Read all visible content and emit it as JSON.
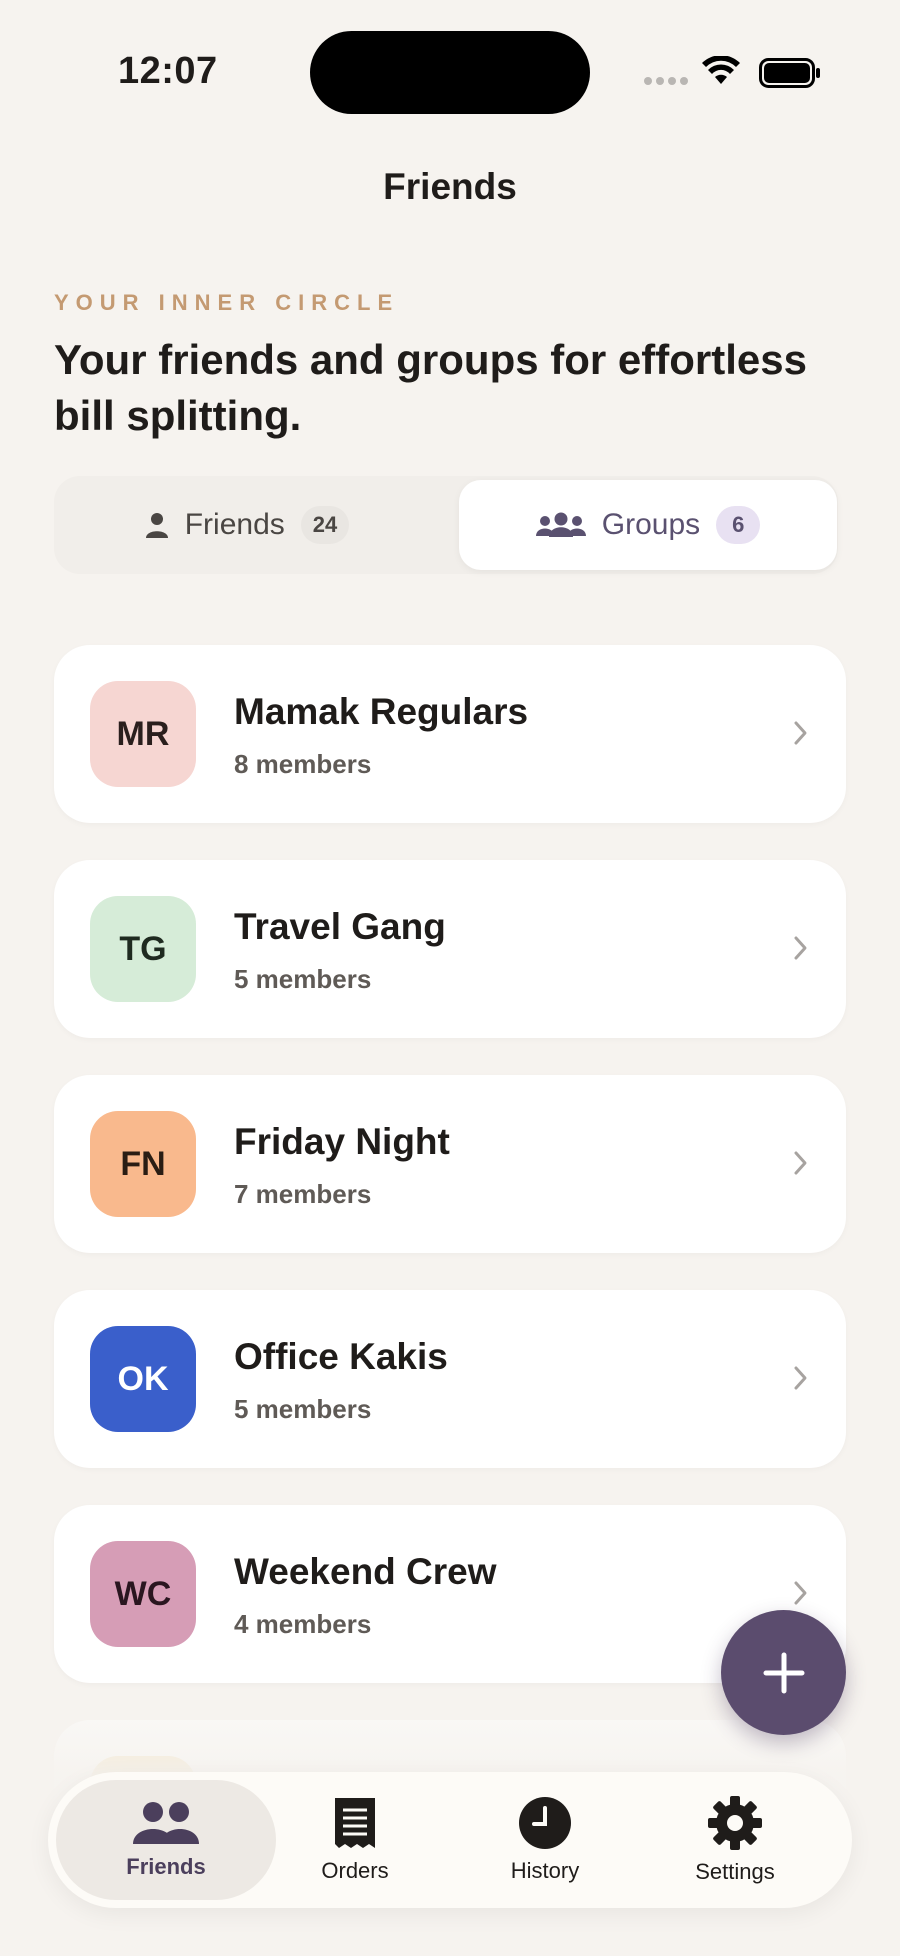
{
  "status_bar": {
    "time": "12:07"
  },
  "nav": {
    "title": "Friends"
  },
  "intro": {
    "eyebrow": "YOUR INNER CIRCLE",
    "headline": "Your friends and groups for effortless bill splitting."
  },
  "segments": {
    "friends": {
      "label": "Friends",
      "count": "24"
    },
    "groups": {
      "label": "Groups",
      "count": "6",
      "selected": true
    }
  },
  "groups": [
    {
      "initials": "MR",
      "name": "Mamak Regulars",
      "members": "8 members",
      "color": "#f6d6d2",
      "text_color": "#2a1f1d"
    },
    {
      "initials": "TG",
      "name": "Travel Gang",
      "members": "5 members",
      "color": "#d6ecd8",
      "text_color": "#1f2a20"
    },
    {
      "initials": "FN",
      "name": "Friday Night",
      "members": "7 members",
      "color": "#f9b98d",
      "text_color": "#2a1d14"
    },
    {
      "initials": "OK",
      "name": "Office Kakis",
      "members": "5 members",
      "color": "#3a5fcb",
      "text_color": "#ffffff"
    },
    {
      "initials": "WC",
      "name": "Weekend Crew",
      "members": "4 members",
      "color": "#d69db6",
      "text_color": "#2a1620"
    }
  ],
  "fab": {
    "icon": "plus-icon"
  },
  "tabbar": [
    {
      "label": "Friends",
      "icon": "people-icon",
      "active": true
    },
    {
      "label": "Orders",
      "icon": "receipt-icon"
    },
    {
      "label": "History",
      "icon": "clock-icon"
    },
    {
      "label": "Settings",
      "icon": "gear-icon"
    }
  ],
  "colors": {
    "accent": "#5b4c6e",
    "eyebrow": "#c49a72",
    "background": "#f6f3ef"
  }
}
